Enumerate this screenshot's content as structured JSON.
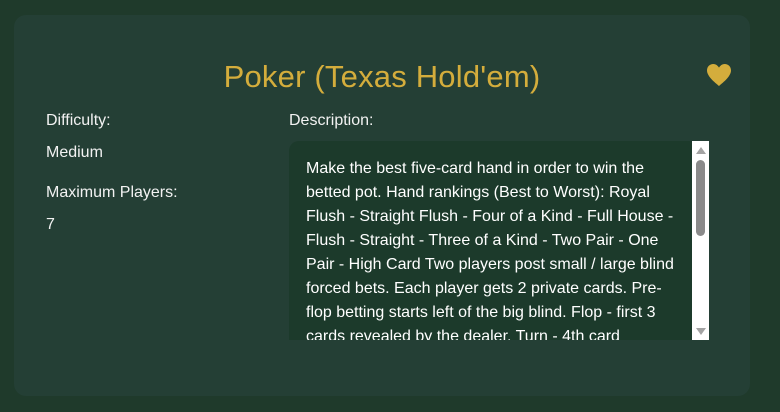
{
  "game": {
    "title": "Poker (Texas Hold'em)",
    "favorite_icon": "heart-icon",
    "accent_color": "#d4ad3c"
  },
  "details": {
    "difficulty_label": "Difficulty:",
    "difficulty_value": "Medium",
    "max_players_label": "Maximum Players:",
    "max_players_value": "7",
    "description_label": "Description:",
    "description_text": "Make the best five-card hand in order to win the betted pot. Hand rankings (Best to Worst): Royal Flush - Straight Flush - Four of a Kind - Full House - Flush - Straight - Three of a Kind - Two Pair - One Pair - High Card Two players post small / large blind forced bets. Each player gets 2 private cards. Pre-flop betting starts left of the big blind. Flop - first 3 cards revealed by the dealer. Turn - 4th card"
  }
}
